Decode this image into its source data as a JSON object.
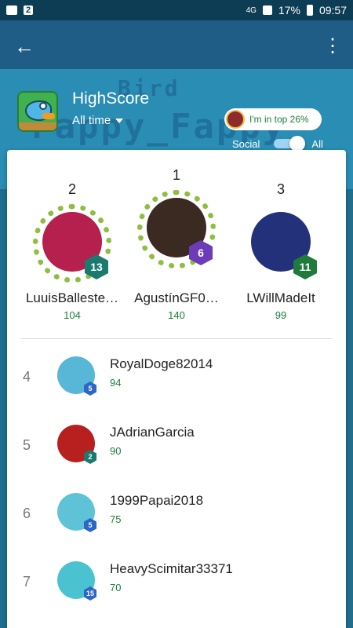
{
  "status_bar": {
    "badge": "2",
    "network": "4G",
    "battery": "17%",
    "time": "09:57"
  },
  "header": {
    "back_icon": "arrow-left-icon",
    "more_icon": "more-vert-icon",
    "title": "HighScore",
    "time_filter": "All time",
    "background_words": [
      "Bird",
      "Fappy_Fappy"
    ],
    "top_percent_label": "I'm in top 26%",
    "toggle": {
      "left_label": "Social",
      "right_label": "All",
      "selected": "All"
    }
  },
  "podium": [
    {
      "rank": "2",
      "name": "LuuisBalleste…",
      "score": "104",
      "level": "13",
      "level_color": "#1b7a6f",
      "avatar_color": "#b5204f"
    },
    {
      "rank": "1",
      "name": "AgustínGF0…",
      "score": "140",
      "level": "6",
      "level_color": "#6c3cb8",
      "avatar_color": "#3a2a22"
    },
    {
      "rank": "3",
      "name": "LWillMadeIt",
      "score": "99",
      "level": "11",
      "level_color": "#1f7a3c",
      "avatar_color": "#23317a"
    }
  ],
  "list": [
    {
      "rank": "4",
      "name": "RoyalDoge82014",
      "score": "94",
      "level": "5",
      "level_color": "#2c66c9",
      "avatar_color": "#58b6d6"
    },
    {
      "rank": "5",
      "name": "JAdrianGarcia",
      "score": "90",
      "level": "2",
      "level_color": "#1b7a6f",
      "avatar_color": "#b82020"
    },
    {
      "rank": "6",
      "name": "1999Papai2018",
      "score": "75",
      "level": "5",
      "level_color": "#2c66c9",
      "avatar_color": "#5fc3d8"
    },
    {
      "rank": "7",
      "name": "HeavyScimitar33371",
      "score": "70",
      "level": "15",
      "level_color": "#2c66c9",
      "avatar_color": "#4bc2d0"
    }
  ]
}
